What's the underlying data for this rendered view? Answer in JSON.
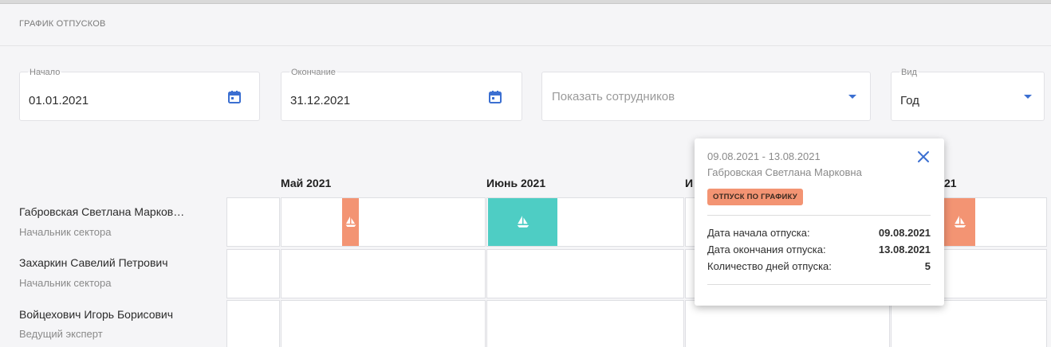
{
  "page": {
    "title": "ГРАФИК ОТПУСКОВ"
  },
  "filters": {
    "start": {
      "label": "Начало",
      "value": "01.01.2021",
      "icon": "calendar-icon"
    },
    "end": {
      "label": "Окончание",
      "value": "31.12.2021",
      "icon": "calendar-icon"
    },
    "employees": {
      "placeholder": "Показать сотрудников",
      "icon": "dropdown-caret-icon"
    },
    "view": {
      "label": "Вид",
      "value": "Год",
      "icon": "dropdown-caret-icon"
    }
  },
  "months": [
    "Май 2021",
    "Июнь 2021",
    "И",
    "21"
  ],
  "employees": [
    {
      "name": "Габровская Светлана Марков…",
      "role": "Начальник сектора"
    },
    {
      "name": "Захаркин Савелий Петрович",
      "role": "Начальник сектора"
    },
    {
      "name": "Войцехович Игорь Борисович",
      "role": "Ведущий эксперт"
    }
  ],
  "vacation_bars": [
    {
      "employee": "Габровская Светлана Марковна",
      "color": "#f39473",
      "icon": "sailboat-icon"
    },
    {
      "employee": "Габровская Светлана Марковна",
      "color": "#4ecdc4",
      "icon": "sailboat-icon"
    },
    {
      "employee": "Габровская Светлана Марковна",
      "color": "#f39473",
      "icon": "sailboat-icon"
    }
  ],
  "popup": {
    "dates": "09.08.2021 - 13.08.2021",
    "employee": "Габровская Светлана Марковна",
    "badge": "ОТПУСК ПО ГРАФИКУ",
    "close_icon": "close-icon",
    "rows": [
      {
        "label": "Дата начала отпуска:",
        "value": "09.08.2021"
      },
      {
        "label": "Дата окончания отпуска:",
        "value": "13.08.2021"
      },
      {
        "label": "Количество дней отпуска:",
        "value": "5"
      }
    ]
  },
  "colors": {
    "accent": "#3b6fd1",
    "vacation_scheduled": "#f39473",
    "vacation_other": "#4ecdc4"
  }
}
